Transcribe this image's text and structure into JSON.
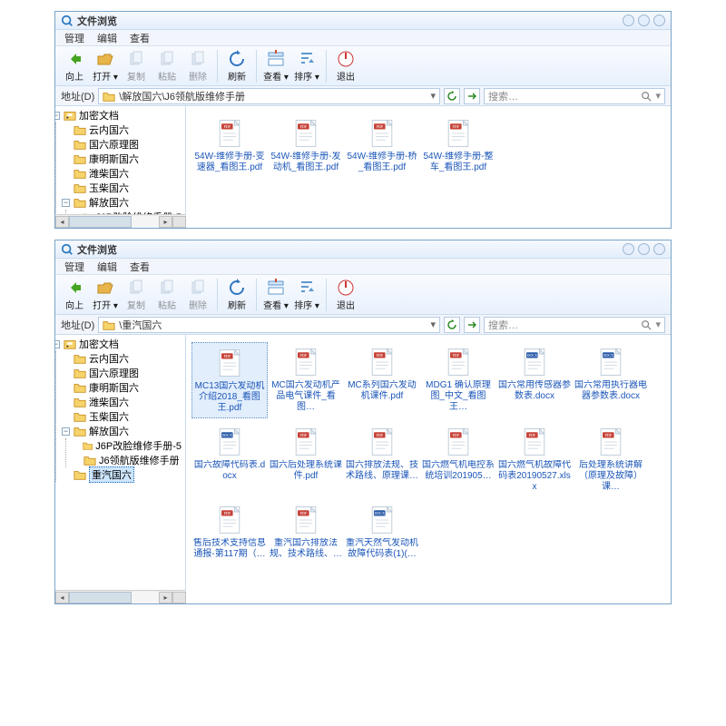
{
  "appTitle": "文件浏览",
  "menus": [
    "管理",
    "编辑",
    "查看"
  ],
  "toolbar": [
    {
      "key": "back",
      "label": "向上",
      "enabled": true,
      "color": "#45a521",
      "dd": false
    },
    {
      "key": "open",
      "label": "打开",
      "enabled": true,
      "color": "#e79a0c",
      "dd": true
    },
    {
      "key": "copy",
      "label": "复制",
      "enabled": false
    },
    {
      "key": "paste",
      "label": "粘贴",
      "enabled": false
    },
    {
      "key": "delete",
      "label": "删除",
      "enabled": false
    },
    {
      "sep": true
    },
    {
      "key": "refresh",
      "label": "刷新",
      "enabled": true,
      "dd": false
    },
    {
      "sep": true
    },
    {
      "key": "view",
      "label": "查看",
      "enabled": true,
      "dd": true
    },
    {
      "key": "sort",
      "label": "排序",
      "enabled": true,
      "dd": true
    },
    {
      "sep": true
    },
    {
      "key": "exit",
      "label": "退出",
      "enabled": true
    }
  ],
  "addrLabel": "地址(D)",
  "searchPlaceholder": "搜索…",
  "tree": {
    "root": {
      "label": "加密文档"
    },
    "children": [
      {
        "label": "云内国六"
      },
      {
        "label": "国六原理图"
      },
      {
        "label": "康明斯国六"
      },
      {
        "label": "潍柴国六"
      },
      {
        "label": "玉柴国六"
      },
      {
        "label": "解放国六",
        "expanded": true,
        "children": [
          {
            "label": "J6P改脸维修手册-5"
          },
          {
            "label": "J6领航版维修手册"
          }
        ]
      },
      {
        "label": "重汽国六"
      }
    ]
  },
  "windows": [
    {
      "path": "\\解放国六\\J6领航版维修手册",
      "selectedTree": "J6领航版维修手册",
      "files": [
        {
          "name": "54W-维修手册-变速器_看图王.pdf",
          "type": "pdf"
        },
        {
          "name": "54W-维修手册-发动机_看图王.pdf",
          "type": "pdf"
        },
        {
          "name": "54W-维修手册-桥_看图王.pdf",
          "type": "pdf"
        },
        {
          "name": "54W-维修手册-整车_看图王.pdf",
          "type": "pdf"
        }
      ],
      "selectedFile": null,
      "contentHeight": 134
    },
    {
      "path": "\\重汽国六",
      "selectedTree": "重汽国六",
      "files": [
        {
          "name": "MC13国六发动机介绍2018_看图王.pdf",
          "type": "pdf",
          "selected": true
        },
        {
          "name": "MC国六发动机产品电气课件_看图…",
          "type": "pdf"
        },
        {
          "name": "MC系列国六发动机课件.pdf",
          "type": "pdf"
        },
        {
          "name": "MDG1 确认原理图_中文_看图王…",
          "type": "pdf"
        },
        {
          "name": "国六常用传感器参数表.docx",
          "type": "docx"
        },
        {
          "name": "国六常用执行器电器参数表.docx",
          "type": "docx"
        },
        {
          "name": "国六故障代码表.docx",
          "type": "docx"
        },
        {
          "name": "国六后处理系统课件.pdf",
          "type": "pdf"
        },
        {
          "name": "国六排放法规、技术路线、原理课…",
          "type": "pdf"
        },
        {
          "name": "国六燃气机电控系统培训201905…",
          "type": "pdf"
        },
        {
          "name": "国六燃气机故障代码表20190527.xlsx",
          "type": "pdf"
        },
        {
          "name": "后处理系统讲解（原理及故障）课…",
          "type": "pdf"
        },
        {
          "name": "售后技术支持信息通报-第117期（…",
          "type": "pdf"
        },
        {
          "name": "重汽国六排放法规、技术路线、…",
          "type": "pdf"
        },
        {
          "name": "重汽天然气发动机故障代码表(1)(…",
          "type": "docx"
        }
      ],
      "contentHeight": 296
    }
  ]
}
